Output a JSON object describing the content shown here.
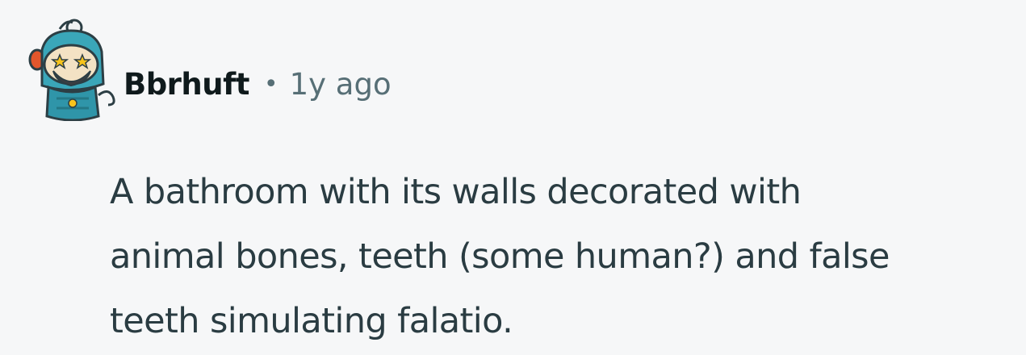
{
  "comment": {
    "avatar_icon": "snoo-astronaut-avatar-icon",
    "author": "Bbrhuft",
    "separator": "•",
    "time_ago": "1y ago",
    "body_lines": [
      "A bathroom with its walls decorated with",
      "animal bones, teeth (some human?) and false",
      "teeth simulating falatio."
    ]
  },
  "colors": {
    "background": "#f6f7f8",
    "author_text": "#0f1a1c",
    "meta_text": "#576f76",
    "body_text": "#2a3c42",
    "avatar_helmet": "#3aa6b9",
    "avatar_face": "#f3e2c4"
  }
}
